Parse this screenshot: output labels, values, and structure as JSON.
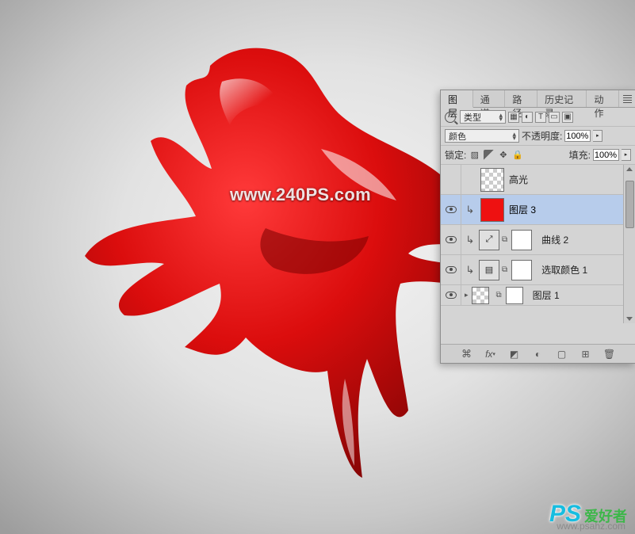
{
  "watermarks": {
    "center": "www.240PS.com",
    "logo_ps": "PS",
    "logo_zh": "爱好者",
    "bottom": "www.psahz.com"
  },
  "panel": {
    "tabs": [
      "图层",
      "通道",
      "路径",
      "历史记录",
      "动作"
    ],
    "active_tab": 0,
    "filter_label": "类型",
    "blend_mode": "颜色",
    "opacity_label": "不透明度:",
    "opacity_value": "100%",
    "lock_label": "锁定:",
    "fill_label": "填充:",
    "fill_value": "100%",
    "layers": [
      {
        "visible": false,
        "clipped": false,
        "thumb": "checker",
        "name": "高光",
        "selected": false
      },
      {
        "visible": true,
        "clipped": true,
        "thumb": "red",
        "name": "图层 3",
        "selected": true
      },
      {
        "visible": true,
        "clipped": true,
        "thumb": "adj-curves",
        "mask": "white",
        "name": "曲线 2",
        "selected": false
      },
      {
        "visible": true,
        "clipped": true,
        "thumb": "adj-sel",
        "mask": "white",
        "name": "选取颜色 1",
        "selected": false
      },
      {
        "visible": true,
        "clipped": false,
        "thumb": "checker",
        "mask": "white",
        "name": "图层 1",
        "selected": false,
        "collapsed": true
      }
    ],
    "bottom_icons": [
      "link",
      "fx",
      "mask",
      "adj",
      "group",
      "new",
      "trash"
    ]
  }
}
